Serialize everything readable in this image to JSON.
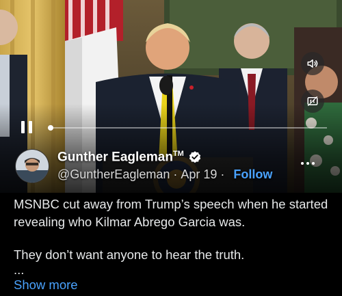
{
  "video": {
    "progress_fraction": 0.01,
    "icons": {
      "mute": "speaker-icon",
      "captions": "captions-icon",
      "pause": "pause-icon",
      "more": "more-icon"
    }
  },
  "tweet": {
    "display_name": "Gunther Eagleman",
    "trademark": "TM",
    "handle": "@GuntherEagleman",
    "separator": "·",
    "date": "Apr 19",
    "follow_label": "Follow",
    "paragraphs": [
      "MSNBC cut away from Trump’s speech when he started revealing who Kilmar Abrego Garcia was.",
      "They don’t want anyone to hear the truth."
    ],
    "truncation": "...",
    "show_more_label": "Show more"
  },
  "colors": {
    "background": "#000000",
    "link": "#4aa3ff",
    "verified": "#ffffff",
    "text": "#e7e9ea"
  }
}
